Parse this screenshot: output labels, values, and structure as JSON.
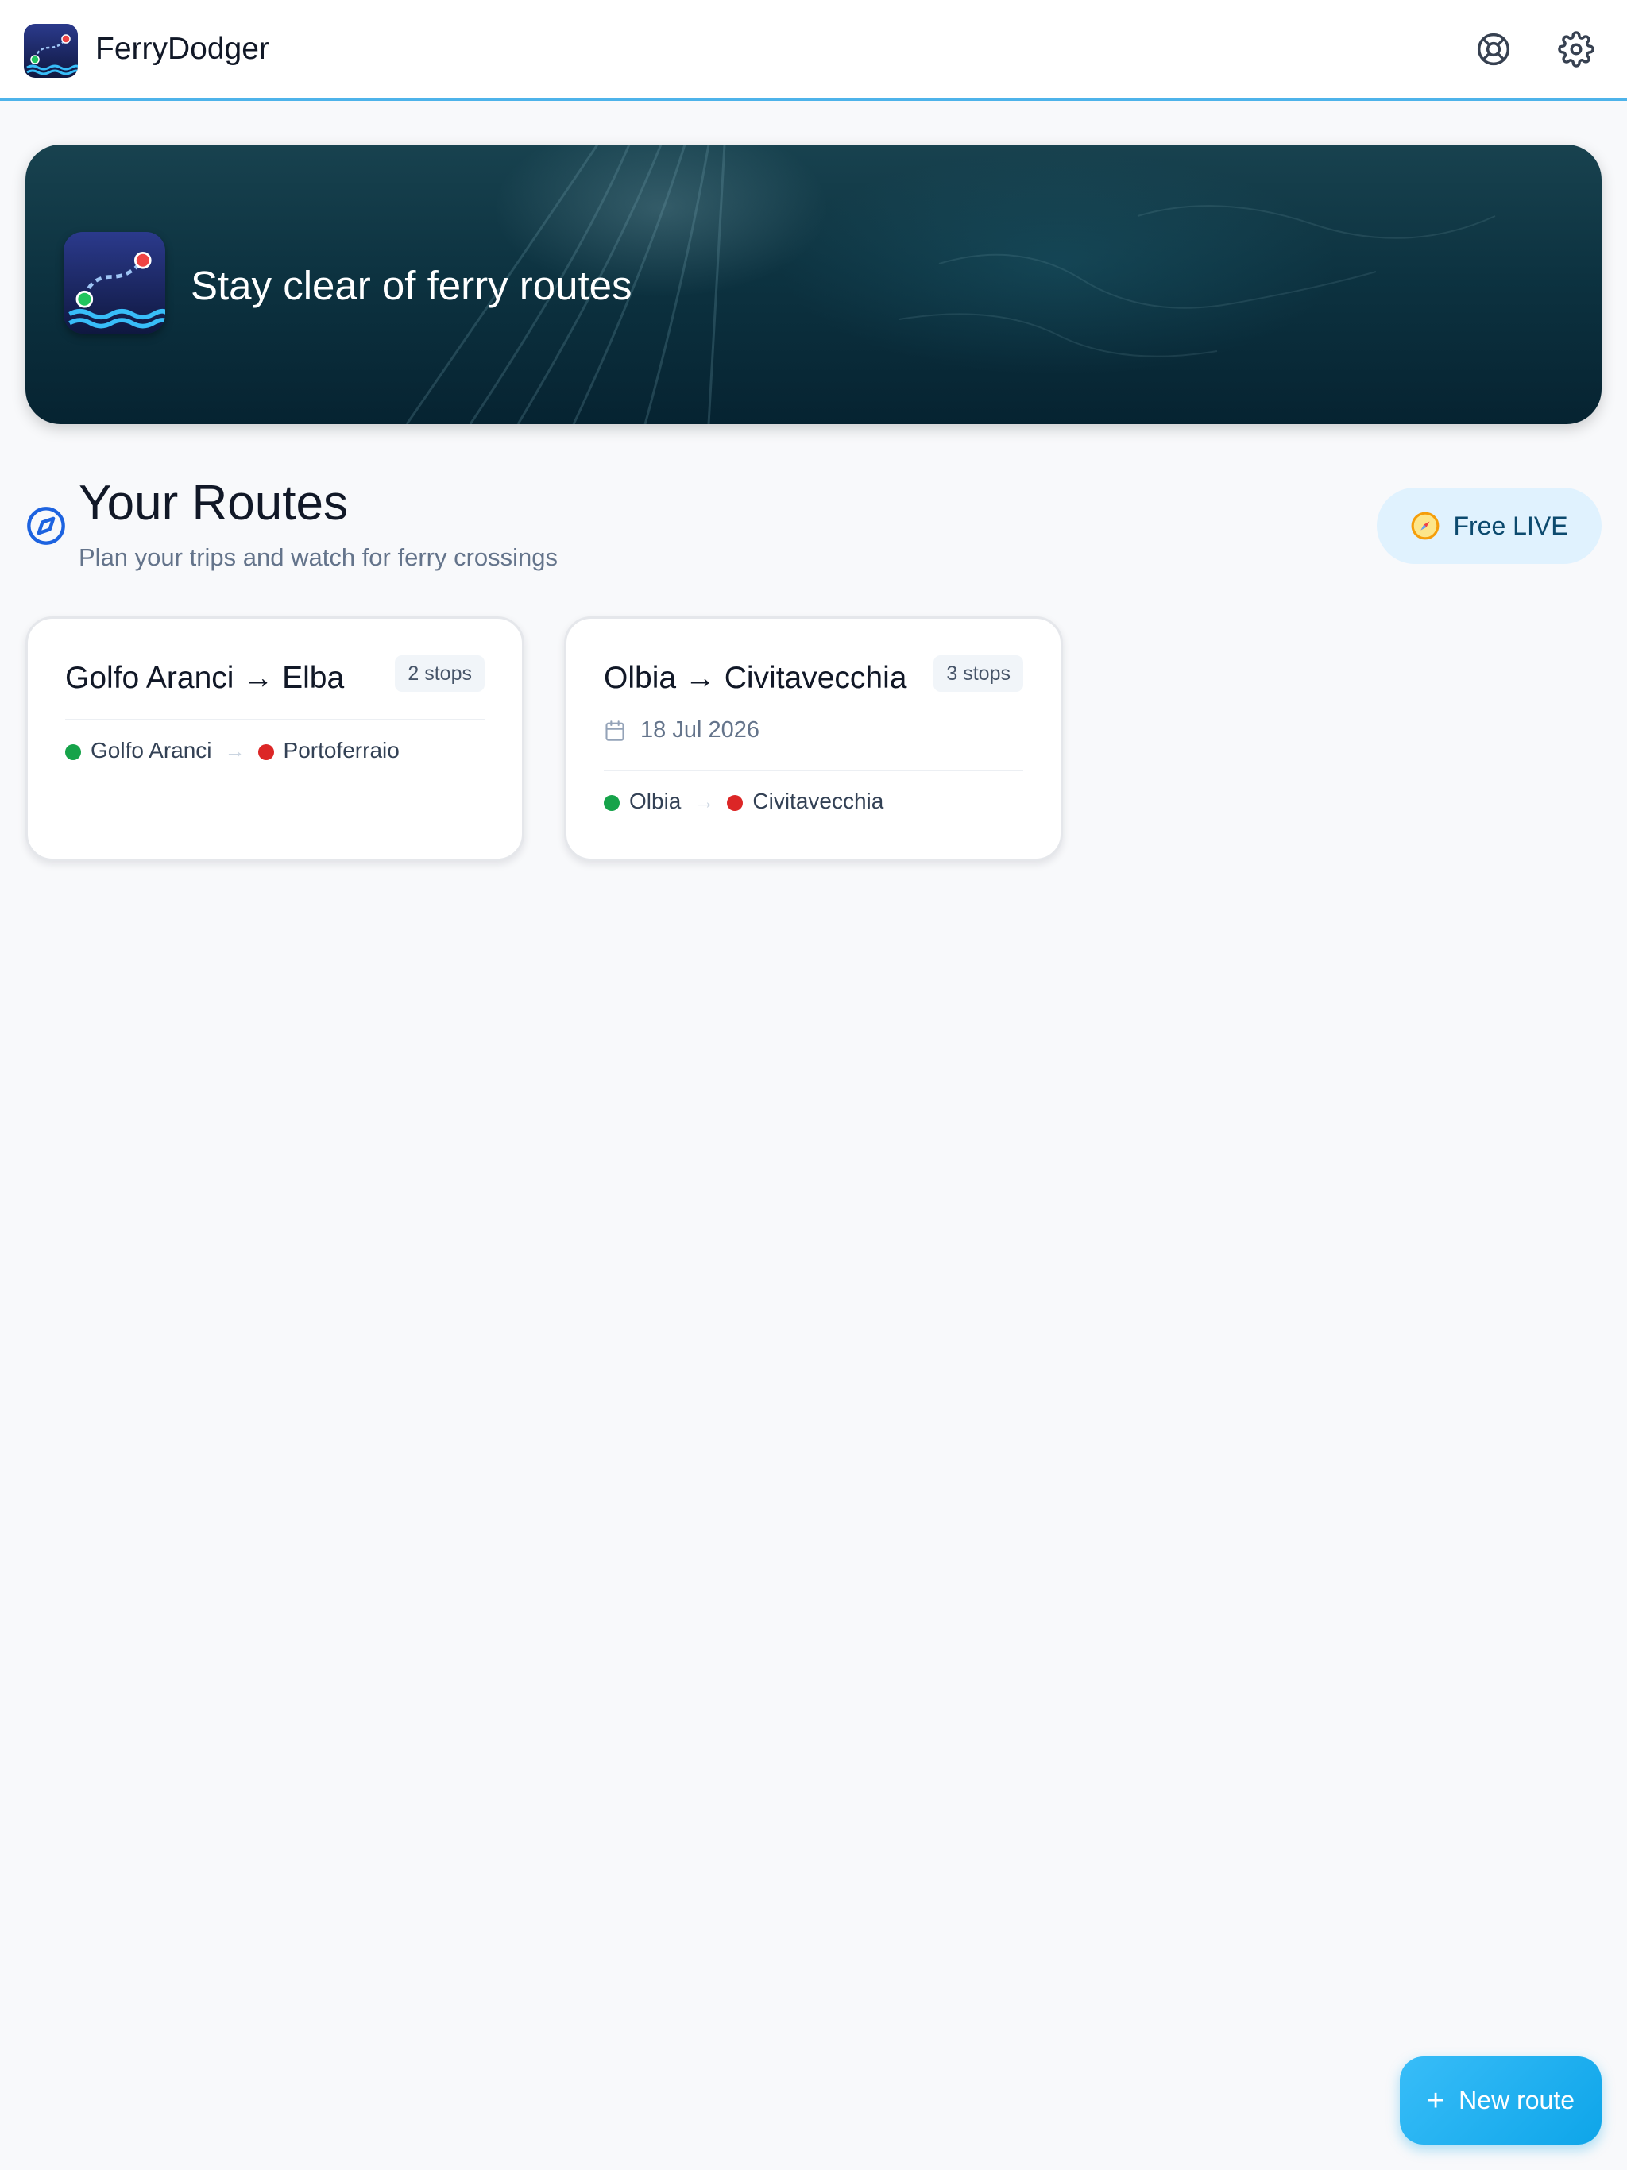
{
  "app": {
    "name": "FerryDodger",
    "logo_icon": "ferry-route-logo",
    "accent_color": "#4db3ea"
  },
  "toolbar": {
    "help_icon": "lifebuoy-icon",
    "settings_icon": "gear-icon"
  },
  "hero": {
    "title": "Stay clear of ferry routes",
    "background": "aerial-sea-photo"
  },
  "section": {
    "icon": "compass-icon",
    "title": "Your Routes",
    "subtitle": "Plan your trips and watch for ferry crossings",
    "live_chip": {
      "icon": "compass-icon",
      "label": "Free LIVE"
    }
  },
  "routes": [
    {
      "title": "Golfo Aranci → Elba",
      "stops_label": "2 stops",
      "date": "",
      "start_stop": "Golfo Aranci",
      "end_stop": "Portoferraio",
      "arrow": "→"
    },
    {
      "title": "Olbia → Civitavecchia",
      "stops_label": "3 stops",
      "date": "18 Jul 2026",
      "start_stop": "Olbia",
      "end_stop": "Civitavecchia",
      "arrow": "→"
    }
  ],
  "fab": {
    "icon": "+",
    "label": "New route",
    "color": "#0ea5e9"
  },
  "colors": {
    "start_dot": "#16a34a",
    "end_dot": "#dc2626",
    "background": "#f8f9fb"
  }
}
